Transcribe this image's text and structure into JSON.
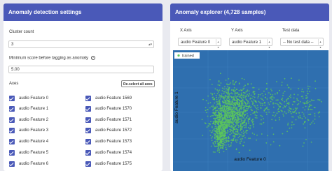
{
  "left_panel": {
    "title": "Anomaly detection settings",
    "cluster_count_label": "Cluster count",
    "cluster_count_value": "3",
    "min_score_label": "Minimum score before tagging as anomaly",
    "help_icon": "?",
    "min_score_value": "5.00",
    "axes_label": "Axes",
    "deselect_button": "De-select all axes",
    "axes_col1": [
      "audio Feature 0",
      "audio Feature 1",
      "audio Feature 2",
      "audio Feature 3",
      "audio Feature 4",
      "audio Feature 5",
      "audio Feature 6"
    ],
    "axes_col2": [
      "audio Feature 1569",
      "audio Feature 1570",
      "audio Feature 1571",
      "audio Feature 1572",
      "audio Feature 1573",
      "audio Feature 1574",
      "audio Feature 1575"
    ]
  },
  "right_panel": {
    "title": "Anomaly explorer (4,728 samples)",
    "x_axis_label": "X Axis",
    "y_axis_label": "Y Axis",
    "test_data_label": "Test data",
    "x_axis_value": "audio Feature 0",
    "y_axis_value": "audio Feature 1",
    "test_data_value": "-- No test data --"
  },
  "chart_data": {
    "type": "scatter",
    "series": [
      {
        "name": "trained",
        "color": "#5cc65c"
      }
    ],
    "xlabel": "audio Feature 0",
    "ylabel": "audio Feature 1",
    "background": "#2f6faf",
    "grid": true,
    "legend": "top-left"
  }
}
